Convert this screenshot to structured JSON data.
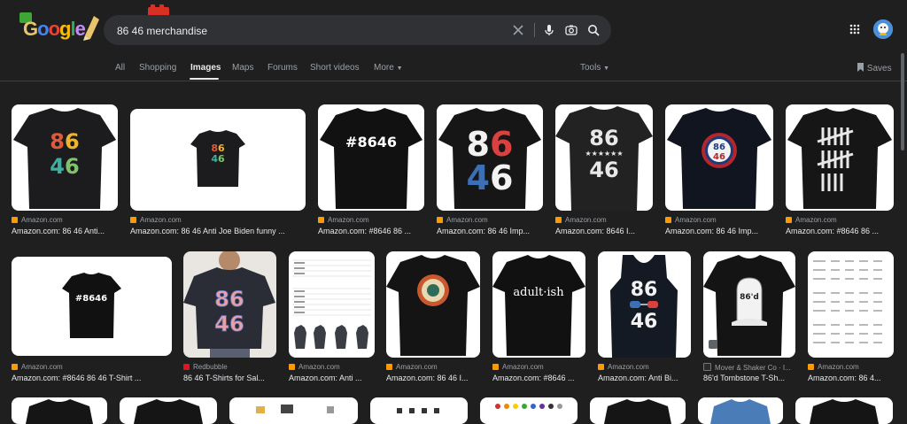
{
  "search": {
    "query": "86 46 merchandise",
    "logo_text": "Google"
  },
  "icons": {
    "clear": "close-icon",
    "voice": "microphone-icon",
    "lens": "camera-lens-icon",
    "search": "search-icon",
    "apps": "apps-grid-icon",
    "saves": "bookmark-icon"
  },
  "tabs": [
    {
      "label": "All"
    },
    {
      "label": "Shopping"
    },
    {
      "label": "Images"
    },
    {
      "label": "Maps"
    },
    {
      "label": "Forums"
    },
    {
      "label": "Short videos"
    },
    {
      "label": "More"
    }
  ],
  "toolbar": {
    "tools_label": "Tools",
    "saves_label": "Saves"
  },
  "colors": {
    "background": "#1f1f1f",
    "searchbar": "#303134",
    "text": "#e8eaed",
    "muted": "#9aa0a6"
  },
  "results_row1": [
    {
      "source": "Amazon.com",
      "title": "Amazon.com: 86 46 Anti...",
      "shirt_text": "86 46"
    },
    {
      "source": "Amazon.com",
      "title": "Amazon.com: 86 46 Anti Joe Biden funny ...",
      "shirt_text": "86 46"
    },
    {
      "source": "Amazon.com",
      "title": "Amazon.com: #8646 86 ...",
      "shirt_text": "#8646"
    },
    {
      "source": "Amazon.com",
      "title": "Amazon.com: 86 46 Imp...",
      "shirt_text": "86 46"
    },
    {
      "source": "Amazon.com",
      "title": "Amazon.com: 8646 I...",
      "shirt_text": "86 46"
    },
    {
      "source": "Amazon.com",
      "title": "Amazon.com: 86 46 Imp...",
      "shirt_text": "86 46"
    },
    {
      "source": "Amazon.com",
      "title": "Amazon.com: #8646 86 ...",
      "shirt_text": ""
    }
  ],
  "results_row2": [
    {
      "source": "Amazon.com",
      "title": "Amazon.com: #8646 86 46 T-Shirt ...",
      "shirt_text": "#8646"
    },
    {
      "source": "Redbubble",
      "title": "86 46 T-Shirts for Sal...",
      "shirt_text": "86 46"
    },
    {
      "source": "Amazon.com",
      "title": "Amazon.com: Anti ...",
      "shirt_text": ""
    },
    {
      "source": "Amazon.com",
      "title": "Amazon.com: 86 46 I...",
      "shirt_text": ""
    },
    {
      "source": "Amazon.com",
      "title": "Amazon.com: #8646 ...",
      "shirt_text": "adult·ish"
    },
    {
      "source": "Amazon.com",
      "title": "Amazon.com: Anti Bi...",
      "shirt_text": "86 46"
    },
    {
      "source": "Mover & Shaker Co · I...",
      "title": "86'd Tombstone T-Sh...",
      "shirt_text": "86'd"
    },
    {
      "source": "Amazon.com",
      "title": "Amazon.com: 86 4...",
      "shirt_text": ""
    }
  ]
}
